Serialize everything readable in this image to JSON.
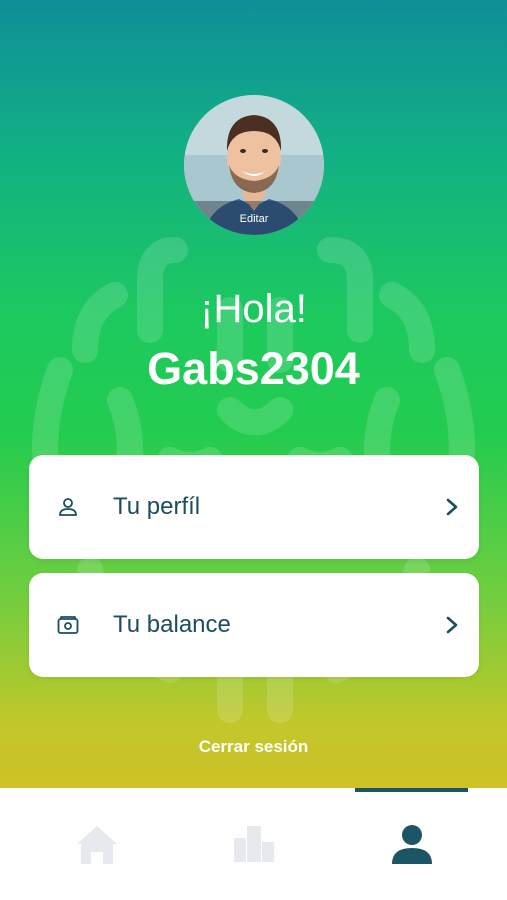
{
  "profile": {
    "edit_label": "Editar",
    "greeting": "¡Hola!",
    "username": "Gabs2304"
  },
  "menu": {
    "items": [
      {
        "label": "Tu perfíl",
        "icon": "user-outline-icon"
      },
      {
        "label": "Tu balance",
        "icon": "wallet-icon"
      }
    ]
  },
  "logout_label": "Cerrar sesión",
  "tabbar": {
    "tabs": [
      {
        "icon": "home-icon",
        "active": false
      },
      {
        "icon": "building-icon",
        "active": false
      },
      {
        "icon": "person-icon",
        "active": true
      }
    ]
  },
  "colors": {
    "text_dark": "#1b4e5f",
    "tab_active": "#1c5566",
    "tab_inactive": "#e6eaee",
    "gradient_top": "#0f8e98",
    "gradient_mid": "#23cc4f",
    "gradient_bottom": "#cfc126"
  }
}
